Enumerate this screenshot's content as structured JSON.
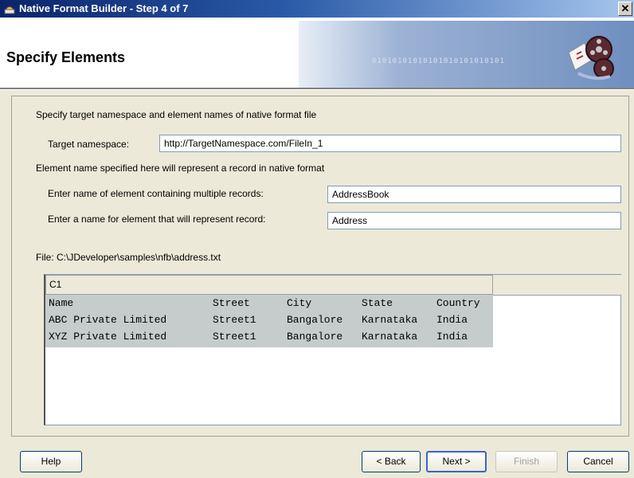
{
  "window": {
    "title": "Native Format Builder - Step 4 of 7"
  },
  "header": {
    "title": "Specify Elements",
    "banner_binary": "01010101010101010101010101"
  },
  "form": {
    "intro": "Specify target namespace and element names of native format file",
    "namespace_label": "Target namespace:",
    "namespace_value": "http://TargetNamespace.com/FileIn_1",
    "note": "Element name specified here will represent a record in native format",
    "multi_label": "Enter name of element containing multiple records:",
    "multi_value": "AddressBook",
    "record_label": "Enter a name for element that will represent record:",
    "record_value": "Address",
    "file_label": "File: C:\\JDeveloper\\samples\\nfb\\address.txt"
  },
  "table": {
    "column_header": "C1",
    "rows": [
      [
        "Name",
        "Street",
        "City",
        "State",
        "Country"
      ],
      [
        "ABC Private Limited",
        "Street1",
        "Bangalore",
        "Karnataka",
        "India"
      ],
      [
        "XYZ Private Limited",
        "Street1",
        "Bangalore",
        "Karnataka",
        "India"
      ]
    ]
  },
  "buttons": {
    "help": "Help",
    "back": "< Back",
    "next": "Next >",
    "finish": "Finish",
    "cancel": "Cancel"
  }
}
